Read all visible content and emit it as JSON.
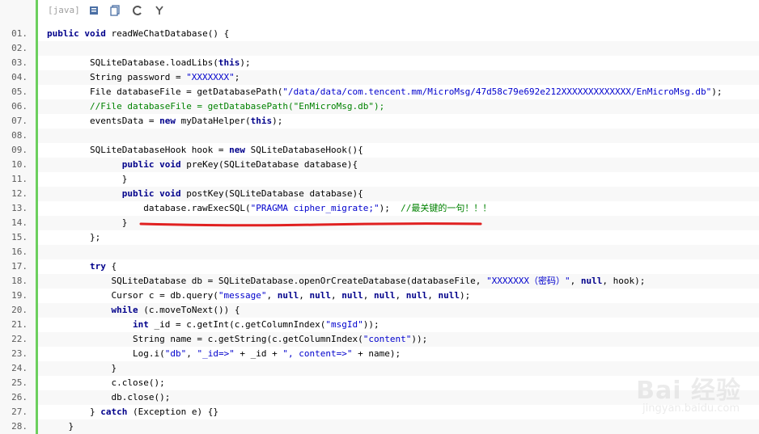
{
  "toolbar": {
    "language_label": "[java]",
    "icons": [
      "view-source-icon",
      "copy-icon",
      "refresh-icon",
      "help-icon"
    ]
  },
  "code_lines": [
    {
      "num": "01.",
      "html": "<span class='kw'>public</span> <span class='kw'>void</span> readWeChatDatabase() {"
    },
    {
      "num": "02.",
      "html": ""
    },
    {
      "num": "03.",
      "html": "        SQLiteDatabase.loadLibs(<span class='kw'>this</span>);"
    },
    {
      "num": "04.",
      "html": "        String password = <span class='str'>\"XXXXXXX\"</span>;"
    },
    {
      "num": "05.",
      "html": "        File databaseFile = getDatabasePath(<span class='str'>\"/data/data/com.tencent.mm/MicroMsg/47d58c79e692e212XXXXXXXXXXXXX/EnMicroMsg.db\"</span>);"
    },
    {
      "num": "06.",
      "html": "        <span class='cmt'>//File databaseFile = getDatabasePath(\"EnMicroMsg.db\");</span>"
    },
    {
      "num": "07.",
      "html": "        eventsData = <span class='kw'>new</span> myDataHelper(<span class='kw'>this</span>);"
    },
    {
      "num": "08.",
      "html": ""
    },
    {
      "num": "09.",
      "html": "        SQLiteDatabaseHook hook = <span class='kw'>new</span> SQLiteDatabaseHook(){"
    },
    {
      "num": "10.",
      "html": "              <span class='kw'>public</span> <span class='kw'>void</span> preKey(SQLiteDatabase database){"
    },
    {
      "num": "11.",
      "html": "              }"
    },
    {
      "num": "12.",
      "html": "              <span class='kw'>public</span> <span class='kw'>void</span> postKey(SQLiteDatabase database){"
    },
    {
      "num": "13.",
      "html": "                  database.rawExecSQL(<span class='str'>\"PRAGMA cipher_migrate;\"</span>);  <span class='cmt'>//最关键的一句！！！</span>"
    },
    {
      "num": "14.",
      "html": "              }"
    },
    {
      "num": "15.",
      "html": "        };"
    },
    {
      "num": "16.",
      "html": ""
    },
    {
      "num": "17.",
      "html": "        <span class='kw'>try</span> {"
    },
    {
      "num": "18.",
      "html": "            SQLiteDatabase db = SQLiteDatabase.openOrCreateDatabase(databaseFile, <span class='str'>\"XXXXXXX（密码）\"</span>, <span class='kw'>null</span>, hook);"
    },
    {
      "num": "19.",
      "html": "            Cursor c = db.query(<span class='str'>\"message\"</span>, <span class='kw'>null</span>, <span class='kw'>null</span>, <span class='kw'>null</span>, <span class='kw'>null</span>, <span class='kw'>null</span>, <span class='kw'>null</span>);"
    },
    {
      "num": "20.",
      "html": "            <span class='kw'>while</span> (c.moveToNext()) {"
    },
    {
      "num": "21.",
      "html": "                <span class='kw'>int</span> _id = c.getInt(c.getColumnIndex(<span class='str'>\"msgId\"</span>));"
    },
    {
      "num": "22.",
      "html": "                String name = c.getString(c.getColumnIndex(<span class='str'>\"content\"</span>));"
    },
    {
      "num": "23.",
      "html": "                Log.i(<span class='str'>\"db\"</span>, <span class='str'>\"_id=>\"</span> + _id + <span class='str'>\", content=>\"</span> + name);"
    },
    {
      "num": "24.",
      "html": "            }"
    },
    {
      "num": "25.",
      "html": "            c.close();"
    },
    {
      "num": "26.",
      "html": "            db.close();"
    },
    {
      "num": "27.",
      "html": "        } <span class='kw'>catch</span> (Exception e) {}"
    },
    {
      "num": "28.",
      "html": "    }"
    }
  ],
  "watermark": {
    "logo": "Bai  经验",
    "url": "jingyan.baidu.com"
  },
  "colors": {
    "gutter_border": "#6ccf5e",
    "keyword": "#00008b",
    "string": "#0000cd",
    "comment": "#008200",
    "underline": "#e02020"
  }
}
